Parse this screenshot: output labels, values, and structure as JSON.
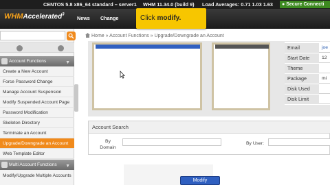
{
  "status_bar": {
    "os": "CENTOS 5.8 x86_64 standard – server1",
    "whm_version": "WHM 11.34.0 (build 9)",
    "load_averages": "Load Averages: 0.71 1.03 1.63",
    "secure_connection": "Secure Connecti"
  },
  "header": {
    "logo_whm": "WHM",
    "logo_accelerated": "Accelerated",
    "logo_sup": "3",
    "nav": [
      "News",
      "Change"
    ]
  },
  "tooltip": {
    "prefix": "Click ",
    "emph": "modify."
  },
  "sidebar": {
    "sections": [
      {
        "label": "Account Functions",
        "icon": "account-functions-icon"
      },
      {
        "label": "Multi Account Functions",
        "icon": "multi-account-icon"
      }
    ],
    "items": [
      "Create a New Account",
      "Force Password Change",
      "Manage Account Suspension",
      "Modify Suspended Account Page",
      "Password Modification",
      "Skeleton Directory",
      "Terminate an Account",
      "Upgrade/Downgrade an Account",
      "Web Template Editor"
    ],
    "multi_items": [
      "Modify/Upgrade Multiple Accounts"
    ],
    "active_item": "Upgrade/Downgrade an Account"
  },
  "breadcrumb": {
    "home": "Home",
    "sep": "»",
    "section": "Account Functions",
    "page": "Upgrade/Downgrade an Account"
  },
  "account_info": {
    "rows": [
      {
        "label": "Email",
        "value": "joe"
      },
      {
        "label": "Start Date",
        "value": "12"
      },
      {
        "label": "Theme",
        "value": ""
      },
      {
        "label": "Package",
        "value": "mi"
      },
      {
        "label": "Disk Used",
        "value": ""
      },
      {
        "label": "Disk Limit",
        "value": ""
      }
    ]
  },
  "account_search": {
    "title": "Account Search",
    "by_domain_label": "By Domain",
    "by_user_label": "By User:",
    "domain_value": "",
    "user_value": ""
  },
  "modify_button": "Modify",
  "colors": {
    "accent_orange": "#f08a1c",
    "tooltip_yellow": "#f7c600",
    "secure_green": "#3d8a20",
    "selection_blue": "#3060c0"
  }
}
